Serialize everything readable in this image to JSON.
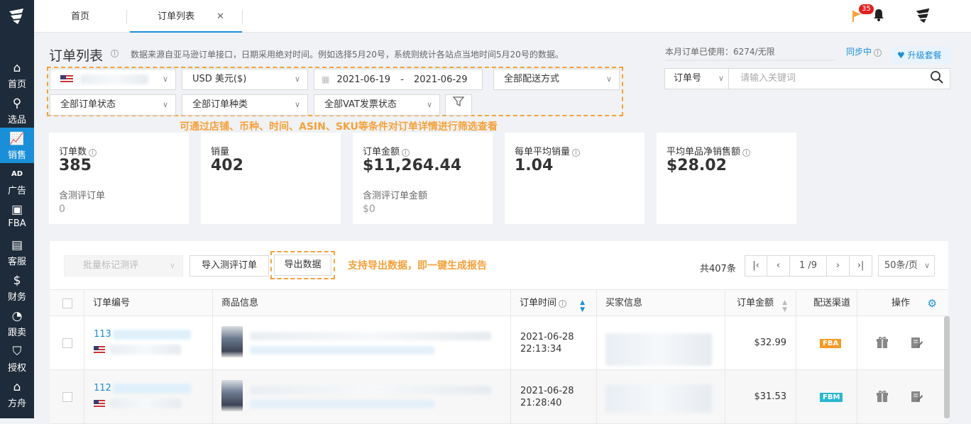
{
  "sidebar": {
    "items": [
      {
        "icon": "home-icon",
        "glyph": "⌂",
        "label": "首页"
      },
      {
        "icon": "search-icon",
        "glyph": "⚲",
        "label": "选品"
      },
      {
        "icon": "chart-icon",
        "glyph": "📈",
        "label": "销售",
        "active": true
      },
      {
        "icon": "ad-icon",
        "glyph": "AD",
        "label": "广告"
      },
      {
        "icon": "fba-icon",
        "glyph": "▣",
        "label": "FBA"
      },
      {
        "icon": "service-icon",
        "glyph": "▤",
        "label": "客服"
      },
      {
        "icon": "finance-icon",
        "glyph": "$",
        "label": "财务"
      },
      {
        "icon": "pie-icon",
        "glyph": "◔",
        "label": "跟卖"
      },
      {
        "icon": "shield-icon",
        "glyph": "⛉",
        "label": "授权"
      },
      {
        "icon": "ark-icon",
        "glyph": "⌂",
        "label": "方舟"
      }
    ]
  },
  "topbar": {
    "tabs": [
      {
        "label": "首页"
      },
      {
        "label": "订单列表",
        "close": "✕"
      }
    ],
    "badge_count": "35"
  },
  "page": {
    "title": "订单列表",
    "description": "数据来源自亚马逊订单接口，日期采用绝对时间。例如选择5月20号，系统则统计各站点当地时间5月20号的数据。",
    "quota": "本月订单已使用：6274/无限",
    "sync_label": "同步中",
    "upgrade_label": "升级套餐"
  },
  "filters": {
    "currency": "USD  美元($)",
    "date_start": "2021-06-19",
    "date_sep": "-",
    "date_end": "2021-06-29",
    "shipping": "全部配送方式",
    "order_status": "全部订单状态",
    "order_type": "全部订单种类",
    "vat_status": "全部VAT发票状态",
    "note": "可通过店铺、币种、时间、ASIN、SKU等条件对订单详情进行筛选查看"
  },
  "search": {
    "type": "订单号",
    "placeholder": "请输入关键词"
  },
  "stats": [
    {
      "label": "订单数",
      "value": "385",
      "sub_label": "含测评订单",
      "sub_value": "0",
      "info": true
    },
    {
      "label": "销量",
      "value": "402",
      "info": false
    },
    {
      "label": "订单金额",
      "value": "$11,264.44",
      "sub_label": "含测评订单金额",
      "sub_value": "$0",
      "info": true
    },
    {
      "label": "每单平均销量",
      "value": "1.04",
      "info": true
    },
    {
      "label": "平均单品净销售额",
      "value": "$28.02",
      "info": true
    }
  ],
  "toolbar": {
    "batch_label": "批量标记测评",
    "import_label": "导入测评订单",
    "export_label": "导出数据",
    "note": "支持导出数据，即一键生成报告",
    "total": "共407条",
    "page_current": "1",
    "page_total": "/9",
    "page_size": "50条/页"
  },
  "table": {
    "headers": {
      "order_no": "订单编号",
      "product": "商品信息",
      "order_time": "订单时间",
      "buyer": "买家信息",
      "amount": "订单金额",
      "channel": "配送渠道",
      "actions": "操作"
    },
    "rows": [
      {
        "order_prefix": "113",
        "date": "2021-06-28",
        "time": "22:13:34",
        "amount": "$32.99",
        "channel": "FBA",
        "channel_color": "#f59a23"
      },
      {
        "order_prefix": "112",
        "date": "2021-06-28",
        "time": "21:28:40",
        "amount": "$31.53",
        "channel": "FBM",
        "channel_color": "#2ab7d0"
      }
    ]
  }
}
